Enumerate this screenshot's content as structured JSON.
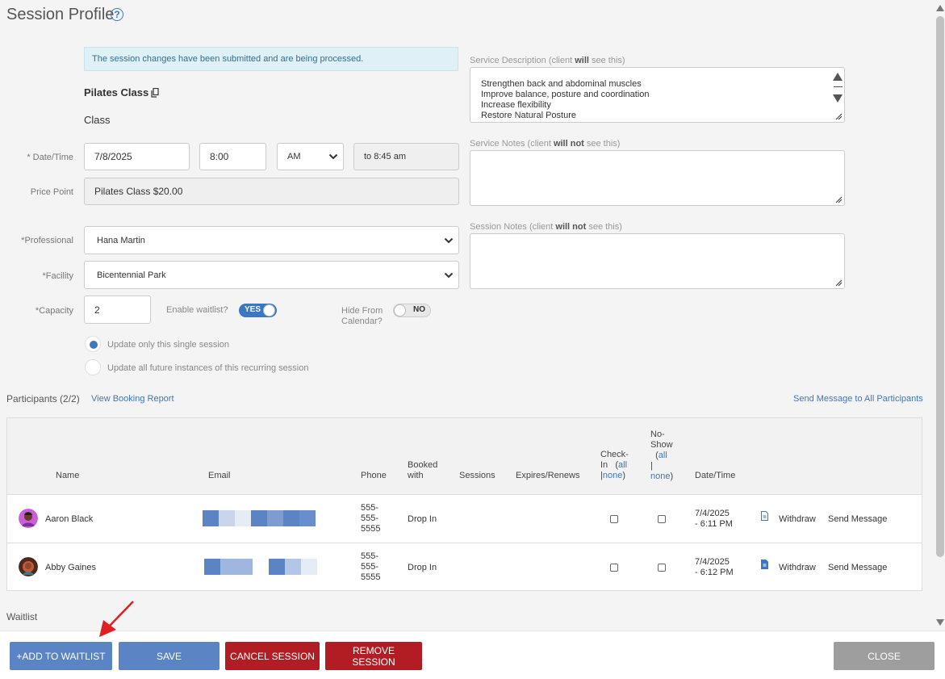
{
  "page": {
    "title": "Session Profile",
    "help_icon": "?",
    "alert": "The session changes have been submitted and are being processed."
  },
  "class": {
    "name": "Pilates Class",
    "type": "Class"
  },
  "form": {
    "datetime_label": "* Date/Time",
    "date": "7/8/2025",
    "time": "8:00",
    "ampm": "AM",
    "end_time": "to 8:45 am",
    "price_point_label": "Price Point",
    "price_point": "Pilates Class $20.00",
    "professional_label": "*Professional",
    "professional": "Hana Martin",
    "facility_label": "*Facility",
    "facility": "Bicentennial Park",
    "capacity_label": "*Capacity",
    "capacity": "2",
    "waitlist_label": "Enable waitlist?",
    "waitlist_toggle": "YES",
    "hide_label_1": "Hide From",
    "hide_label_2": "Calendar?",
    "hide_toggle": "NO",
    "radio_single": "Update only this single session",
    "radio_all": "Update all future instances of this recurring session"
  },
  "service_description": {
    "label_pre": "Service Description (client ",
    "label_bold": "will",
    "label_post": " see this)",
    "lines": [
      "Strengthen back and abdominal muscles",
      "Improve balance, posture and coordination",
      "Increase flexibility",
      "Restore Natural Posture"
    ]
  },
  "service_notes": {
    "label_pre": "Service Notes (client ",
    "label_bold": "will not",
    "label_post": " see this)"
  },
  "session_notes": {
    "label_pre": "Session Notes (client ",
    "label_bold": "will not",
    "label_post": " see this)"
  },
  "participants": {
    "heading": "Participants (2/2)",
    "report_link": "View Booking Report",
    "send_all_link": "Send Message to All Participants",
    "headers": {
      "name": "Name",
      "email": "Email",
      "phone": "Phone",
      "booked_1": "Booked",
      "booked_2": "with",
      "sessions": "Sessions",
      "expires": "Expires/Renews",
      "checkin_1": "Check-",
      "checkin_2": "In",
      "all": "all",
      "none": "none",
      "noshow_1": "No-",
      "noshow_2": "Show",
      "datetime": "Date/Time"
    },
    "rows": [
      {
        "name": "Aaron Black",
        "phone": [
          "555-",
          "555-",
          "5555"
        ],
        "booked": "Drop In",
        "date_1": "7/4/2025",
        "date_2": "- 6:11 PM",
        "withdraw": "Withdraw",
        "send": "Send Message"
      },
      {
        "name": "Abby Gaines",
        "phone": [
          "555-",
          "555-",
          "5555"
        ],
        "booked": "Drop In",
        "date_1": "7/4/2025",
        "date_2": "- 6:12 PM",
        "withdraw": "Withdraw",
        "send": "Send Message"
      }
    ]
  },
  "waitlist": {
    "heading": "Waitlist"
  },
  "footer": {
    "add_waitlist": "+ADD TO WAITLIST",
    "save": "SAVE",
    "cancel": "CANCEL SESSION",
    "remove": "REMOVE SESSION",
    "close": "CLOSE"
  },
  "colors": {
    "accent": "#3a78c3",
    "danger": "#b21d24",
    "button_blue": "#5b84c4",
    "alert_bg": "#dff0f7"
  },
  "icons": [
    "help-icon",
    "copy-icon",
    "chevron-down-icon",
    "resize-icon",
    "document-icon",
    "arrow-annotation"
  ]
}
